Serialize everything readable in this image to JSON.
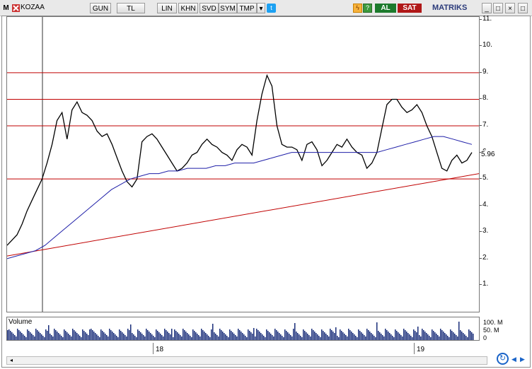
{
  "toolbar": {
    "logo": "M",
    "symbol": "KOZAA",
    "buttons": [
      "GUN",
      "TL",
      "LIN",
      "KHN",
      "SVD",
      "SYM",
      "TMP"
    ],
    "buy_label": "AL",
    "sell_label": "SAT",
    "brand": "MATRIKS"
  },
  "price_axis": {
    "ticks": [
      "11.",
      "10.",
      "9.",
      "8.",
      "7.",
      "6.",
      "5.",
      "4.",
      "3.",
      "2.",
      "1."
    ],
    "current_value": "5.96"
  },
  "volume": {
    "label": "Volume",
    "ticks": [
      "100. M",
      "50. M",
      "0"
    ]
  },
  "time_axis": {
    "ticks": [
      "18",
      "19"
    ]
  },
  "colors": {
    "price_line": "#000000",
    "moving_average": "#1f1fa8",
    "support_lines": "#c00000",
    "volume_bars": "#1a2e7a",
    "buy_button": "#1c7a2c",
    "sell_button": "#b01818"
  },
  "chart_data": {
    "type": "line",
    "y_range": [
      0,
      11.1
    ],
    "horizontal_levels": [
      9.0,
      8.0,
      7.0,
      5.0
    ],
    "trendline": {
      "from": [
        0,
        2.1
      ],
      "to": [
        1,
        5.2
      ]
    },
    "series": [
      {
        "values": [
          2.5,
          2.7,
          2.9,
          3.3,
          3.8,
          4.2,
          4.6,
          5.0,
          5.6,
          6.3,
          7.2,
          7.5,
          6.5,
          7.6,
          7.9,
          7.5,
          7.4,
          7.2,
          6.8,
          6.6,
          6.7,
          6.3,
          5.8,
          5.3,
          4.9,
          4.7,
          5.0,
          6.4,
          6.6,
          6.7,
          6.5,
          6.2,
          5.9,
          5.6,
          5.3,
          5.4,
          5.6,
          5.9,
          6.0,
          6.3,
          6.5,
          6.3,
          6.2,
          6.0,
          5.9,
          5.7,
          6.1,
          6.3,
          6.2,
          5.9,
          7.2,
          8.2,
          8.9,
          8.5,
          7.0,
          6.3,
          6.2,
          6.2,
          6.1,
          5.7,
          6.3,
          6.4,
          6.1,
          5.5,
          5.7,
          6.0,
          6.3,
          6.2,
          6.5,
          6.2,
          6.0,
          5.9,
          5.4,
          5.6,
          6.0,
          6.9,
          7.8,
          8.0,
          8.0,
          7.7,
          7.5,
          7.6,
          7.8,
          7.5,
          7.0,
          6.6,
          6.0,
          5.4,
          5.3,
          5.7,
          5.9,
          5.6,
          5.7,
          6.0
        ]
      },
      {
        "values": [
          2.0,
          2.1,
          2.2,
          2.3,
          2.5,
          2.8,
          3.1,
          3.4,
          3.7,
          4.0,
          4.3,
          4.6,
          4.8,
          5.0,
          5.1,
          5.2,
          5.2,
          5.3,
          5.3,
          5.4,
          5.4,
          5.4,
          5.5,
          5.5,
          5.6,
          5.6,
          5.6,
          5.7,
          5.8,
          5.9,
          6.0,
          6.0,
          6.0,
          6.0,
          6.0,
          6.0,
          6.0,
          6.0,
          6.0,
          6.0,
          6.1,
          6.2,
          6.3,
          6.4,
          6.5,
          6.6,
          6.6,
          6.5,
          6.4,
          6.3
        ]
      }
    ]
  }
}
